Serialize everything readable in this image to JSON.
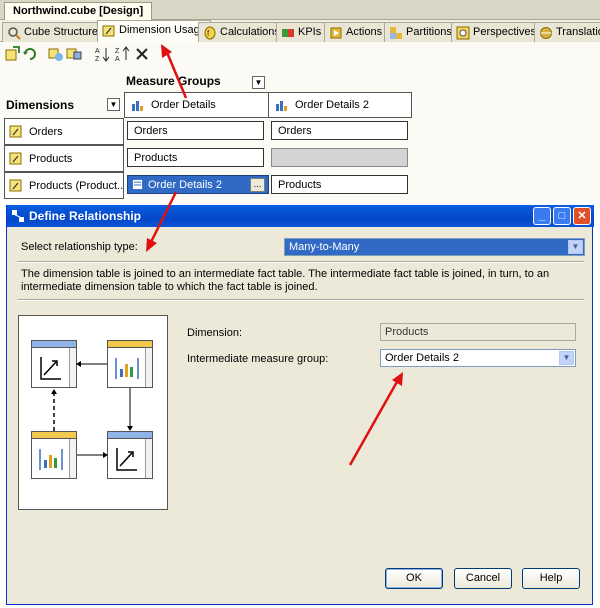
{
  "document_tab": "Northwind.cube [Design]",
  "designer_tabs": [
    "Cube Structure",
    "Dimension Usage",
    "Calculations",
    "KPIs",
    "Actions",
    "Partitions",
    "Perspectives",
    "Translation"
  ],
  "active_designer_tab": "Dimension Usage",
  "grid": {
    "measure_groups_label": "Measure Groups",
    "dimensions_label": "Dimensions",
    "measure_group_headers": [
      "Order Details",
      "Order Details 2"
    ],
    "dimensions": [
      "Orders",
      "Products",
      "Products (Product..."
    ],
    "cells": [
      [
        "Orders",
        "Orders"
      ],
      [
        "Products",
        ""
      ],
      [
        "Order Details 2",
        "Products"
      ]
    ],
    "ellipsis": "..."
  },
  "dialog": {
    "title": "Define Relationship",
    "relationship_type_label": "Select relationship type:",
    "relationship_type_value": "Many-to-Many",
    "description": "The dimension table is joined to an intermediate fact table. The intermediate fact table is joined, in turn, to an intermediate dimension table to which the fact table is joined.",
    "dimension_label": "Dimension:",
    "dimension_value": "Products",
    "intermediate_label": "Intermediate measure group:",
    "intermediate_value": "Order Details 2",
    "ok": "OK",
    "cancel": "Cancel",
    "help": "Help"
  },
  "colors": {
    "annotation_arrow": "#e01010",
    "selection": "#316ac5",
    "title_bar": "#0a5fe0"
  }
}
